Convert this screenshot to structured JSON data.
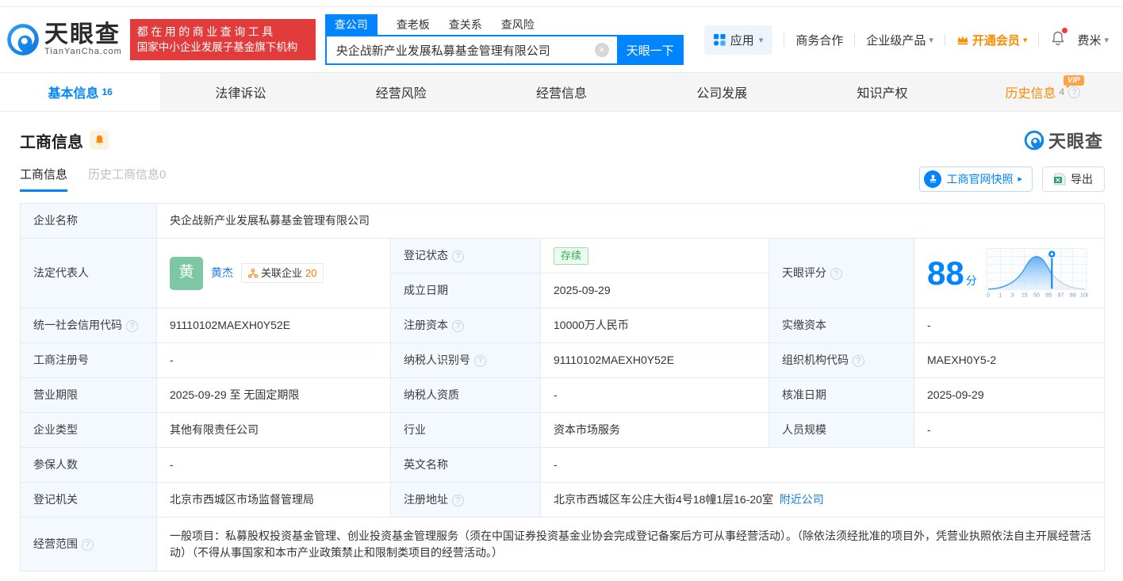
{
  "brand": {
    "logo_text": "天眼查",
    "logo_domain": "TianYanCha.com",
    "slogan_line1": "都在用的商业查询工具",
    "slogan_line2": "国家中小企业发展子基金旗下机构",
    "watermark": "天眼查"
  },
  "search": {
    "tabs": [
      {
        "label": "查公司",
        "active": true
      },
      {
        "label": "查老板",
        "active": false
      },
      {
        "label": "查关系",
        "active": false
      },
      {
        "label": "查风险",
        "active": false
      }
    ],
    "value": "央企战新产业发展私募基金管理有限公司",
    "button_label": "天眼一下"
  },
  "header_nav": {
    "apps_label": "应用",
    "coop_label": "商务合作",
    "enterprise_label": "企业级产品",
    "vip_label": "开通会员",
    "user_label": "费米"
  },
  "main_tabs": {
    "basic": "基本信息",
    "basic_count": "16",
    "legal": "法律诉讼",
    "risk": "经营风险",
    "operating": "经营信息",
    "development": "公司发展",
    "ip": "知识产权",
    "history": "历史信息",
    "history_count": "4"
  },
  "section": {
    "title": "工商信息",
    "sub_tab_active": "工商信息",
    "sub_tab_history": "历史工商信息0",
    "snapshot_label": "工商官网快照",
    "export_label": "导出"
  },
  "score": {
    "label": "天眼评分",
    "value": "88",
    "unit": "分"
  },
  "fields": {
    "name_label": "企业名称",
    "name": "央企战新产业发展私募基金管理有限公司",
    "legal_rep_label": "法定代表人",
    "legal_rep_avatar": "黄",
    "legal_rep_name": "黄杰",
    "related_label": "关联企业",
    "related_count": "20",
    "reg_status_label": "登记状态",
    "reg_status": "存续",
    "est_date_label": "成立日期",
    "est_date": "2025-09-29",
    "uscc_label": "统一社会信用代码",
    "uscc": "91110102MAEXH0Y52E",
    "reg_capital_label": "注册资本",
    "reg_capital": "10000万人民币",
    "paid_capital_label": "实缴资本",
    "paid_capital": "-",
    "reg_no_label": "工商注册号",
    "reg_no": "-",
    "taxpayer_id_label": "纳税人识别号",
    "taxpayer_id": "91110102MAEXH0Y52E",
    "org_code_label": "组织机构代码",
    "org_code": "MAEXH0Y5-2",
    "term_label": "营业期限",
    "term": "2025-09-29 至 无固定期限",
    "taxpayer_quality_label": "纳税人资质",
    "taxpayer_quality": "-",
    "approve_date_label": "核准日期",
    "approve_date": "2025-09-29",
    "company_type_label": "企业类型",
    "company_type": "其他有限责任公司",
    "industry_label": "行业",
    "industry": "资本市场服务",
    "staff_size_label": "人员规模",
    "staff_size": "-",
    "insured_label": "参保人数",
    "insured": "-",
    "english_name_label": "英文名称",
    "english_name": "-",
    "reg_authority_label": "登记机关",
    "reg_authority": "北京市西城区市场监督管理局",
    "address_label": "注册地址",
    "address": "北京市西城区车公庄大街4号18幢1层16-20室",
    "nearby_link": "附近公司",
    "scope_label": "经营范围",
    "scope": "一般项目：私募股权投资基金管理、创业投资基金管理服务（须在中国证券投资基金业协会完成登记备案后方可从事经营活动）。（除依法须经批准的项目外，凭营业执照依法自主开展经营活动）（不得从事国家和本市产业政策禁止和限制类项目的经营活动。）"
  },
  "icons": {
    "help": "?",
    "clear": "×",
    "caret": "▾",
    "arrow": "▸",
    "vip": "VIP"
  },
  "colors": {
    "accent": "#0084ff",
    "vip_orange": "#ff8a00",
    "brand_red": "#e23b3b",
    "status_green": "#2bb148",
    "avatar_green": "#7ec7a4"
  },
  "chart_data": {
    "type": "area",
    "title": "天眼评分分布曲线",
    "x_ticks": [
      "0",
      "1",
      "3",
      "15",
      "50",
      "85",
      "97",
      "99",
      "100"
    ],
    "score_marker": 88,
    "peak_at": 50,
    "legend_position": "none",
    "grid": true
  }
}
